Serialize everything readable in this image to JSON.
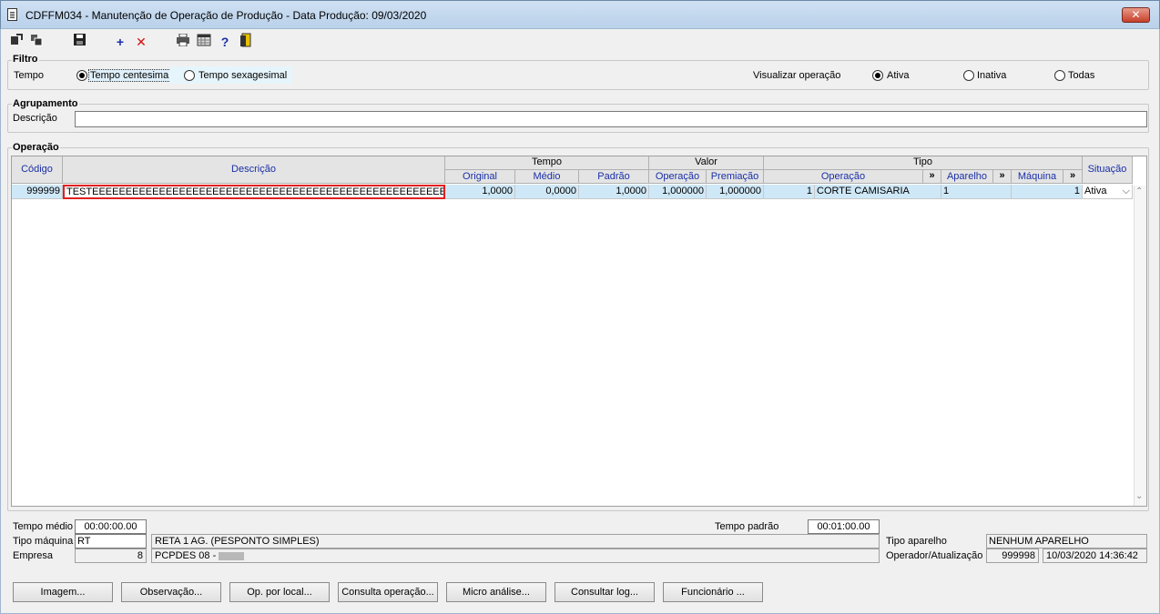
{
  "window": {
    "title": "CDFFM034 - Manutenção de Operação de Produção - Data Produção: 09/03/2020",
    "close": "✕"
  },
  "toolbar": {
    "icons": [
      "export-icon",
      "copy-icon",
      "save-icon",
      "add-icon",
      "delete-icon",
      "print-icon",
      "calculator-icon",
      "help-icon",
      "exit-door-icon"
    ],
    "add": "+",
    "delete": "✕",
    "help": "?"
  },
  "filtro": {
    "title": "Filtro",
    "tempo_label": "Tempo",
    "tempo_options": [
      "Tempo centesimal",
      "Tempo sexagesimal"
    ],
    "tempo_selected": "Tempo centesimal",
    "visualizar_label": "Visualizar operação",
    "visualizar_options": [
      "Ativa",
      "Inativa",
      "Todas"
    ],
    "visualizar_selected": "Ativa"
  },
  "agrupamento": {
    "title": "Agrupamento",
    "descricao_label": "Descrição",
    "descricao_value": ""
  },
  "operacao": {
    "title": "Operação",
    "headers": {
      "codigo": "Código",
      "descricao": "Descrição",
      "tempo": "Tempo",
      "original": "Original",
      "medio": "Médio",
      "padrao": "Padrão",
      "valor": "Valor",
      "valor_operacao": "Operação",
      "premiacao": "Premiação",
      "tipo": "Tipo",
      "tipo_operacao": "Operação",
      "expand": "»",
      "aparelho": "Aparelho",
      "maquina": "Máquina",
      "situacao": "Situação"
    },
    "rows": [
      {
        "codigo": "999999",
        "descricao": "TESTEEEEEEEEEEEEEEEEEEEEEEEEEEEEEEEEEEEEEEEEEEEEEEEEEEEEEEEEEEEEEEEEEEEEEEE",
        "original": "1,0000",
        "medio": "0,0000",
        "padrao": "1,0000",
        "valor_operacao": "1,000000",
        "premiacao": "1,000000",
        "tipo_operacao_code": "1",
        "tipo_operacao_desc": "CORTE CAMISARIA",
        "aparelho": "1",
        "maquina": "1",
        "situacao": "Ativa"
      }
    ]
  },
  "footer": {
    "tempo_medio_label": "Tempo médio",
    "tempo_medio_value": "00:00:00.00",
    "tempo_padrao_label": "Tempo padrão",
    "tempo_padrao_value": "00:01:00.00",
    "tipo_maquina_label": "Tipo máquina",
    "tipo_maquina_code": "RT",
    "tipo_maquina_desc": "RETA 1 AG. (PESPONTO SIMPLES)",
    "empresa_label": "Empresa",
    "empresa_code": "8",
    "empresa_desc": "PCPDES 08 -",
    "tipo_aparelho_label": "Tipo aparelho",
    "tipo_aparelho_value": "NENHUM APARELHO",
    "operador_label": "Operador/Atualização",
    "operador_value": "999998",
    "atualizacao_value": "10/03/2020 14:36:42"
  },
  "buttons": [
    "Imagem...",
    "Observação...",
    "Op. por local...",
    "Consulta operação...",
    "Micro análise...",
    "Consultar log...",
    "Funcionário ..."
  ]
}
